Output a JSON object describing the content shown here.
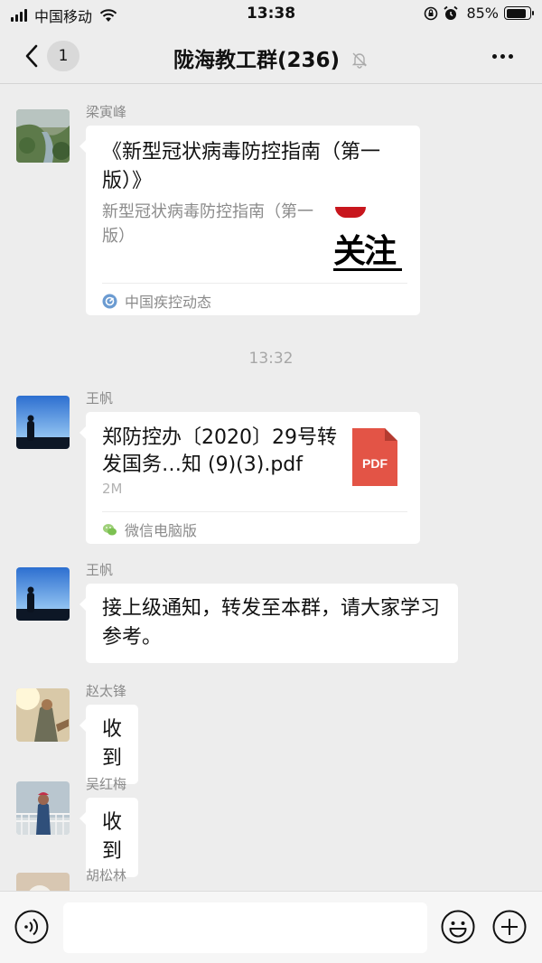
{
  "status_bar": {
    "carrier": "中国移动",
    "time": "13:38",
    "battery": "85%",
    "battery_level": 0.85
  },
  "nav": {
    "back_count": "1",
    "title": "陇海教工群(236)"
  },
  "messages": [
    {
      "type": "article",
      "sender": "梁寅峰",
      "title": "《新型冠状病毒防控指南（第一版）》",
      "description": "新型冠状病毒防控指南（第一版）",
      "thumbnail_text": "关注",
      "source": "中国疾控动态"
    },
    {
      "type": "file",
      "sender": "王帆",
      "file_name": "郑防控办〔2020〕29号转发国务…知 (9)(3).pdf",
      "file_size": "2M",
      "file_type": "PDF",
      "source": "微信电脑版"
    },
    {
      "type": "text",
      "sender": "王帆",
      "text": "接上级通知，转发至本群，请大家学习参考。"
    },
    {
      "type": "text",
      "sender": "赵太锋",
      "text": "收到"
    },
    {
      "type": "text",
      "sender": "吴红梅",
      "text": "收到"
    },
    {
      "type": "text",
      "sender": "胡松林",
      "text": ""
    }
  ],
  "timestamp": "13:32",
  "input": {
    "value": "",
    "placeholder": ""
  },
  "colors": {
    "background": "#ededed",
    "pdf_red": "#e35446",
    "bubble": "#ffffff"
  }
}
